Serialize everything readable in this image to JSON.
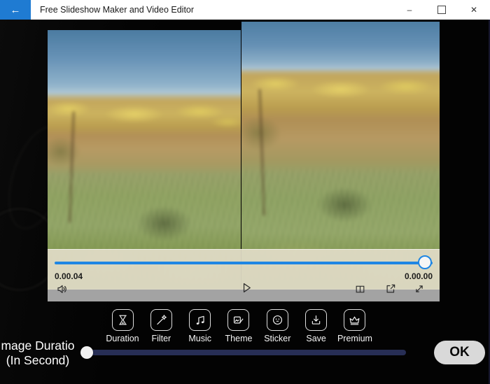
{
  "titlebar": {
    "back_icon": "←",
    "title": "Free Slideshow Maker and Video Editor",
    "minimize_icon": "–",
    "close_icon": "✕"
  },
  "player": {
    "elapsed": "0.00.04",
    "remaining": "0.00.00",
    "seek_progress_pct": 98,
    "control_icons": {
      "mute": "speaker-icon",
      "play": "play-icon",
      "compare": "compare-panes-icon",
      "export": "export-icon",
      "fullscreen": "fullscreen-icon"
    }
  },
  "toolbar": {
    "items": [
      {
        "label": "Duration",
        "icon": "hourglass-icon"
      },
      {
        "label": "Filter",
        "icon": "magic-wand-icon"
      },
      {
        "label": "Music",
        "icon": "music-note-icon"
      },
      {
        "label": "Theme",
        "icon": "picture-edit-icon"
      },
      {
        "label": "Sticker",
        "icon": "smiley-icon"
      },
      {
        "label": "Save",
        "icon": "download-icon"
      },
      {
        "label": "Premium",
        "icon": "crown-icon"
      }
    ]
  },
  "duration_control": {
    "label_line1": "mage Duratio",
    "label_line2": "(In Second)",
    "slider_value_pct": 1,
    "ok_label": "OK"
  },
  "colors": {
    "accent_blue": "#1e86e3",
    "back_button_blue": "#1f7bd2",
    "overlay_beige": "#e1dcc7",
    "control_strip_gray": "#a3a3a3",
    "duration_track_navy": "#272e55",
    "ok_button_bg": "#d9d9d9"
  }
}
